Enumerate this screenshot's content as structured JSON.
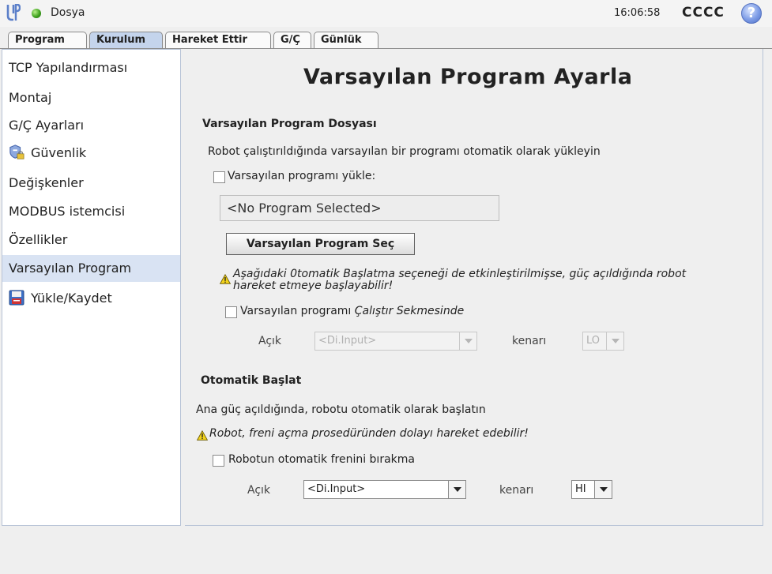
{
  "topbar": {
    "file_label": "Dosya",
    "clock": "16:06:58",
    "robot_name": "CCCC",
    "help_icon": "?"
  },
  "tabs": [
    "Program",
    "Kurulum",
    "Hareket Ettir",
    "G/Ç",
    "Günlük"
  ],
  "sidebar": {
    "items": [
      {
        "label": "TCP Yapılandırması"
      },
      {
        "label": "Montaj"
      },
      {
        "label": "G/Ç Ayarları"
      },
      {
        "label": "Güvenlik",
        "icon": "shield-lock-icon"
      },
      {
        "label": "Değişkenler"
      },
      {
        "label": "MODBUS istemcisi"
      },
      {
        "label": "Özellikler"
      },
      {
        "label": "Varsayılan Program"
      },
      {
        "label": "Yükle/Kaydet",
        "icon": "floppy-disk-icon"
      }
    ],
    "active_index": 7
  },
  "main": {
    "title": "Varsayılan Program Ayarla",
    "default_file": {
      "heading": "Varsayılan Program Dosyası",
      "description": "Robot çalıştırıldığında varsayılan bir programı otomatik olarak yükleyin",
      "load_checkbox_label": "Varsayılan programı yükle:",
      "program_field_value": "<No Program Selected>",
      "select_button": "Varsayılan Program Seç",
      "warning_line1": "Aşağıdaki 0tomatik Başlatma seçeneği de etkinleştirilmişse, güç açıldığında robot",
      "warning_line2": "hareket etmeye başlayabilir!",
      "run_checkbox_label": "Varsayılan programı ",
      "run_checkbox_label_italic": "Çalıştır Sekmesinde",
      "open_label": "Açık",
      "input_select_value": "<Di.Input>",
      "edge_label": "kenarı",
      "edge_select_value": "LO"
    },
    "autostart": {
      "heading": "Otomatik Başlat",
      "description": "Ana güç açıldığında, robotu otomatik olarak başlatın",
      "warning": "Robot, freni açma prosedüründen dolayı hareket edebilir!",
      "brake_checkbox_label": "Robotun otomatik frenini bırakma",
      "open_label": "Açık",
      "input_select_value": "<Di.Input>",
      "edge_label": "kenarı",
      "edge_select_value": "HI"
    }
  },
  "colors": {
    "active_tab": "#c4d4ec",
    "active_sidebar": "#d9e3f3",
    "warning_yellow": "#f2d21b",
    "status_green": "#3fa21e"
  }
}
